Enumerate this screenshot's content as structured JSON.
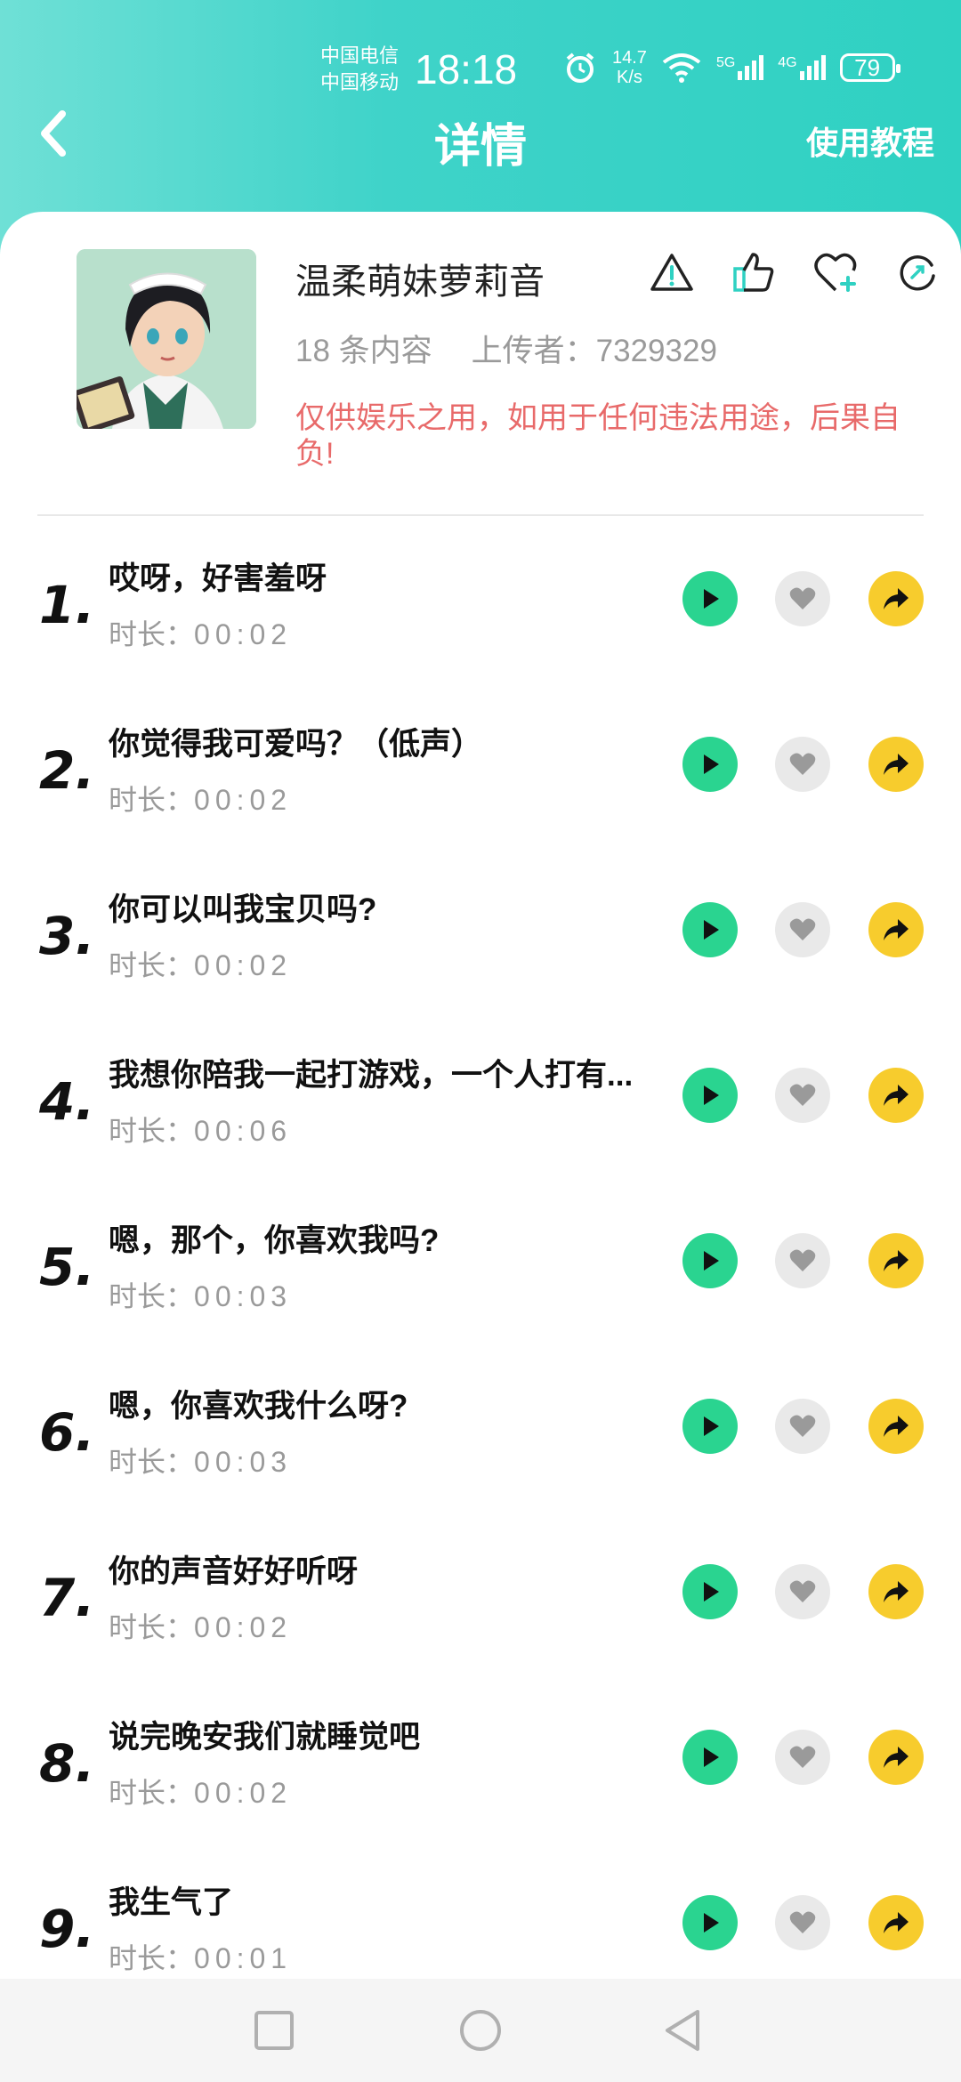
{
  "status_bar": {
    "carrier1": "中国电信",
    "carrier2": "中国移动",
    "time": "18:18",
    "speed_value": "14.7",
    "speed_unit": "K/s",
    "net1": "5G",
    "net2": "4G",
    "battery": "79"
  },
  "nav": {
    "title": "详情",
    "tutorial_label": "使用教程"
  },
  "pack": {
    "name": "温柔萌妹萝莉音",
    "count_text": "18 条内容",
    "uploader_text": "上传者：7329329",
    "disclaimer": "仅供娱乐之用，如用于任何违法用途，后果自负!"
  },
  "duration_label": "时长：",
  "items": [
    {
      "num": "1.",
      "title": "哎呀，好害羞呀",
      "duration": "00:02"
    },
    {
      "num": "2.",
      "title": "你觉得我可爱吗？（低声）",
      "duration": "00:02"
    },
    {
      "num": "3.",
      "title": "你可以叫我宝贝吗?",
      "duration": "00:02"
    },
    {
      "num": "4.",
      "title": "我想你陪我一起打游戏，一个人打有...",
      "duration": "00:06"
    },
    {
      "num": "5.",
      "title": "嗯，那个，你喜欢我吗?",
      "duration": "00:03"
    },
    {
      "num": "6.",
      "title": "嗯，你喜欢我什么呀?",
      "duration": "00:03"
    },
    {
      "num": "7.",
      "title": "你的声音好好听呀",
      "duration": "00:02"
    },
    {
      "num": "8.",
      "title": "说完晚安我们就睡觉吧",
      "duration": "00:02"
    },
    {
      "num": "9.",
      "title": "我生气了",
      "duration": "00:01"
    }
  ],
  "colors": {
    "header_teal": "#2fd1c2",
    "play_green": "#2ad490",
    "share_yellow": "#f7cc2d",
    "warning_red": "#e86a6a"
  }
}
